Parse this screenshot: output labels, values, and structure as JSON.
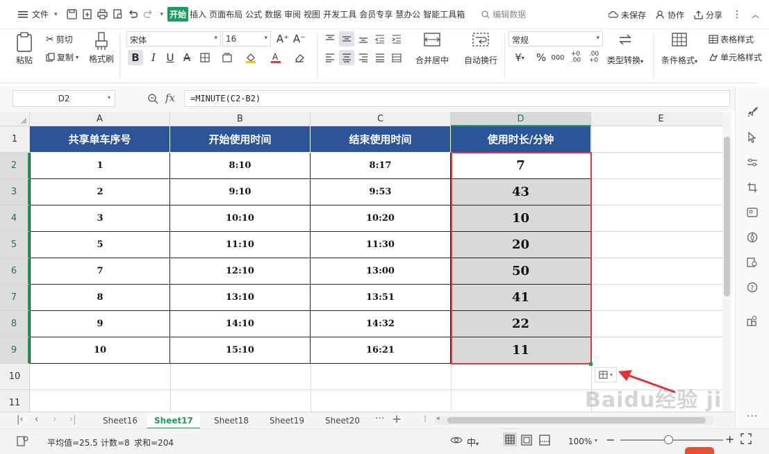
{
  "menu": {
    "file": "文件",
    "tabs": [
      "开始",
      "插入",
      "页面布局",
      "公式",
      "数据",
      "审阅",
      "视图",
      "开发工具",
      "会员专享",
      "慧办公",
      "智能工具箱"
    ],
    "search_placeholder": "编辑数据",
    "unsaved": "未保存",
    "collaborate": "协作",
    "share": "分享"
  },
  "ribbon": {
    "paste": "粘贴",
    "cut": "剪切",
    "copy": "复制",
    "format_painter": "格式刷",
    "font_name": "宋体",
    "font_size": "16",
    "merge_center": "合并居中",
    "wrap_text": "自动换行",
    "number_format": "常规",
    "type_convert": "类型转换",
    "conditional_format": "条件格式",
    "table_style": "表格样式",
    "cell_style": "单元格样式"
  },
  "formula_bar": {
    "name_box": "D2",
    "fx": "fx",
    "formula": "=MINUTE(C2-B2)"
  },
  "columns": [
    "A",
    "B",
    "C",
    "D",
    "E"
  ],
  "rows": [
    "1",
    "2",
    "3",
    "4",
    "5",
    "6",
    "7",
    "8",
    "9",
    "10",
    "11"
  ],
  "table": {
    "headers": [
      "共享单车序号",
      "开始使用时间",
      "结束使用时间",
      "使用时长/分钟"
    ],
    "data": [
      [
        "1",
        "8:10",
        "8:17",
        "7"
      ],
      [
        "2",
        "9:10",
        "9:53",
        "43"
      ],
      [
        "3",
        "10:10",
        "10:20",
        "10"
      ],
      [
        "5",
        "11:10",
        "11:30",
        "20"
      ],
      [
        "7",
        "12:10",
        "13:00",
        "50"
      ],
      [
        "8",
        "13:10",
        "13:51",
        "41"
      ],
      [
        "9",
        "14:10",
        "14:32",
        "22"
      ],
      [
        "10",
        "15:10",
        "16:21",
        "11"
      ]
    ]
  },
  "sheets": [
    "Sheet16",
    "Sheet17",
    "Sheet18",
    "Sheet19",
    "Sheet20"
  ],
  "active_sheet": "Sheet17",
  "status": {
    "average": "平均值=25.5",
    "count": "计数=8",
    "sum": "求和=204",
    "zoom": "100%"
  },
  "watermark": "Baidu经验 jingyan.baidu.com",
  "colors": {
    "accent": "#1a9e58",
    "header_bg": "#2c5499",
    "selection_border": "#e03a3a",
    "selected_fill": "#d9d9d9"
  }
}
